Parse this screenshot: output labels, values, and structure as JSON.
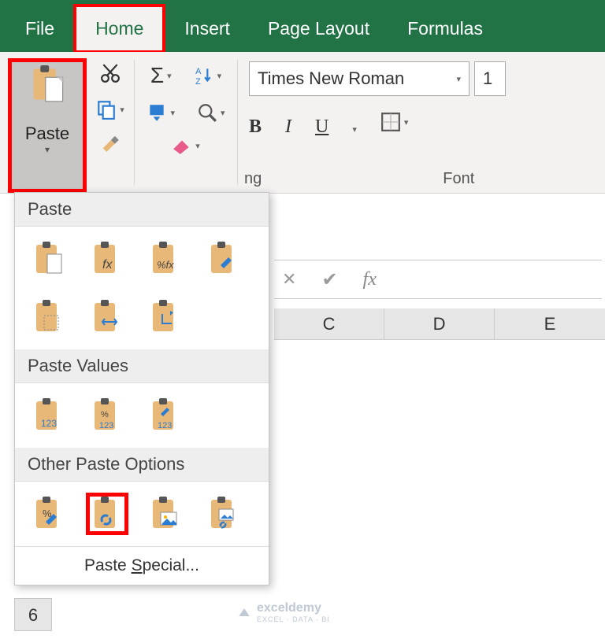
{
  "tabs": {
    "file": "File",
    "home": "Home",
    "insert": "Insert",
    "page_layout": "Page Layout",
    "formulas": "Formulas"
  },
  "clipboard": {
    "paste_label": "Paste"
  },
  "ribbon_groups": {
    "ng_suffix": "ng",
    "font": "Font"
  },
  "font": {
    "name": "Times New Roman",
    "size": "1",
    "bold": "B",
    "italic": "I",
    "underline": "U"
  },
  "formula_bar": {
    "cancel": "✕",
    "enter": "✔",
    "fx": "fx"
  },
  "columns": {
    "c": "C",
    "d": "D",
    "e": "E"
  },
  "row_label": "6",
  "paste_menu": {
    "section_paste": "Paste",
    "section_values": "Paste Values",
    "section_other": "Other Paste Options",
    "special": "Paste Special...",
    "icons": {
      "paste": "paste",
      "paste_fx": "fx",
      "paste_pctfx": "%fx",
      "paste_src_fmt": "brush",
      "paste_noborder": "noborder",
      "paste_colwidth": "colwidth",
      "paste_transpose": "transpose",
      "val_123": "123",
      "val_pct123": "%123",
      "val_fmt123": "brush123",
      "other_fmt": "fmt",
      "other_link": "link",
      "other_pic": "pic",
      "other_linkpic": "linkpic"
    }
  },
  "watermark": {
    "brand": "exceldemy",
    "sub": "EXCEL · DATA · BI"
  }
}
